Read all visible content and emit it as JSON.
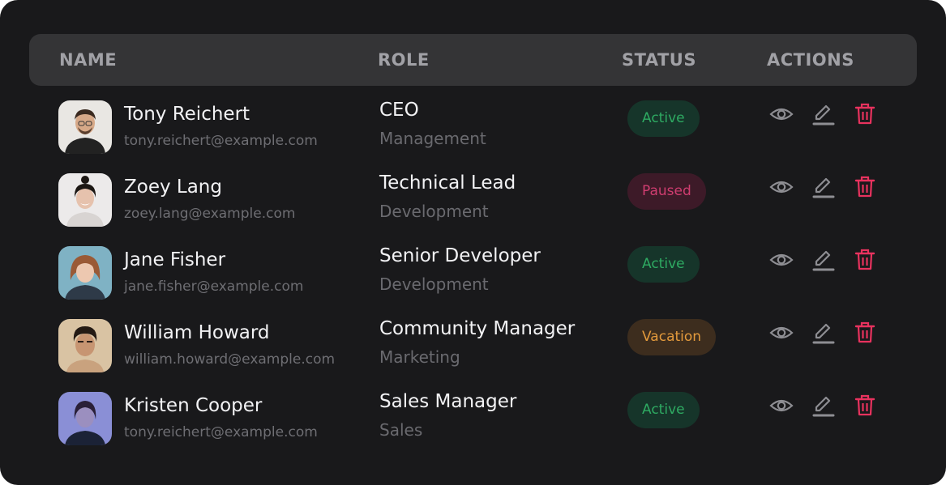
{
  "colors": {
    "card_bg": "#19191b",
    "header_bg": "#343436",
    "active_bg": "#16352a",
    "active_text": "#2eaa62",
    "paused_bg": "#3d1a28",
    "paused_text": "#cf3d70",
    "vacation_bg": "#3d2d1e",
    "vacation_text": "#e39a3c",
    "delete_icon": "#e8325e",
    "action_icon": "#8e8e93"
  },
  "table": {
    "headers": {
      "name": "NAME",
      "role": "ROLE",
      "status": "STATUS",
      "actions": "ACTIONS"
    },
    "action_icons": [
      "eye-icon",
      "pencil-icon",
      "trash-icon"
    ],
    "rows": [
      {
        "name": "Tony Reichert",
        "email": "tony.reichert@example.com",
        "role": "CEO",
        "department": "Management",
        "status": "Active",
        "status_kind": "active"
      },
      {
        "name": "Zoey Lang",
        "email": "zoey.lang@example.com",
        "role": "Technical Lead",
        "department": "Development",
        "status": "Paused",
        "status_kind": "paused"
      },
      {
        "name": "Jane Fisher",
        "email": "jane.fisher@example.com",
        "role": "Senior Developer",
        "department": "Development",
        "status": "Active",
        "status_kind": "active"
      },
      {
        "name": "William Howard",
        "email": "william.howard@example.com",
        "role": "Community Manager",
        "department": "Marketing",
        "status": "Vacation",
        "status_kind": "vacation"
      },
      {
        "name": "Kristen Cooper",
        "email": "tony.reichert@example.com",
        "role": "Sales Manager",
        "department": "Sales",
        "status": "Active",
        "status_kind": "active"
      }
    ]
  }
}
